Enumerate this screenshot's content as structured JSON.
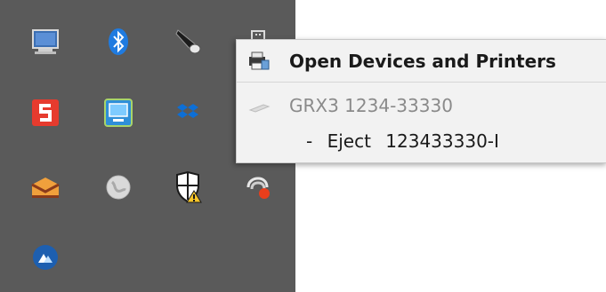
{
  "tray": {
    "icons": [
      {
        "name": "computer-icon"
      },
      {
        "name": "bluetooth-icon"
      },
      {
        "name": "speaker-icon"
      },
      {
        "name": "usb-device-icon"
      },
      {
        "name": "slides-app-icon"
      },
      {
        "name": "display-settings-icon"
      },
      {
        "name": "dropbox-icon"
      },
      {
        "name": "inbox-app-icon"
      },
      {
        "name": "globe-icon"
      },
      {
        "name": "security-warning-icon"
      },
      {
        "name": "sync-error-icon"
      },
      {
        "name": "cloud-sync-icon"
      }
    ]
  },
  "menu": {
    "open_devices_label": "Open Devices and Printers",
    "device_label": "GRX3 1234-33330",
    "eject_label": "- Eject 123433330-I"
  },
  "colors": {
    "tray_bg": "#5a5a5a",
    "menu_bg": "#f2f2f2",
    "disabled_text": "#8a8a8a",
    "text": "#1a1a1a"
  }
}
